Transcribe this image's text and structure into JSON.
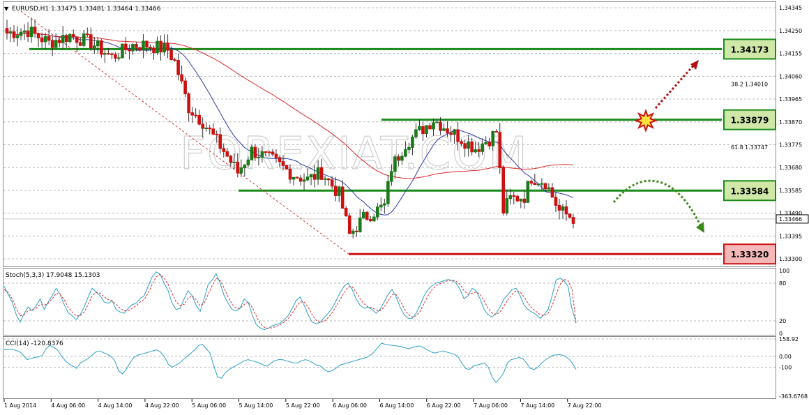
{
  "header": {
    "symbol_line": "EURUSD,H1  1.33475  1.33481  1.33464  1.33466",
    "stoch_label": "Stoch(5,3,3) 17.9048 15.1303",
    "cci_label": "CCI(14) -120.8376"
  },
  "watermark": "FOREXIAT.COM",
  "colors": {
    "support_resistance": "#1a8a1a",
    "low_level": "#cc1111",
    "bull_candle": "#1a7a1a",
    "bear_candle": "#cc1111",
    "fast_ma": "#2a3aa8",
    "slow_ma": "#dd2a2a",
    "stoch_main": "#2aa0c8",
    "stoch_signal": "#dd2a2a",
    "cci_line": "#2aa0c8",
    "up_arrow": "#b01010",
    "down_arrow": "#3a8a1a",
    "level_box_green": "#cfe8a8",
    "level_box_red": "#f5b8b8"
  },
  "chart_data": [
    {
      "type": "candlestick",
      "title": "EURUSD,H1",
      "ylim": [
        1.3328,
        1.3436
      ],
      "yticks": [
        "1.34345",
        "1.34250",
        "1.34155",
        "1.34060",
        "1.33965",
        "1.33870",
        "1.33775",
        "1.33680",
        "1.33585",
        "1.33490",
        "1.33395",
        "1.33300"
      ],
      "xticks": [
        "1 Aug 2014",
        "4 Aug 06:00",
        "4 Aug 14:00",
        "4 Aug 22:00",
        "5 Aug 06:00",
        "5 Aug 14:00",
        "5 Aug 22:00",
        "6 Aug 06:00",
        "6 Aug 14:00",
        "6 Aug 22:00",
        "7 Aug 06:00",
        "7 Aug 14:00",
        "7 Aug 22:00"
      ],
      "current_price": "1.33466",
      "levels": [
        {
          "label": "1.34173",
          "value": 1.34173,
          "kind": "resistance"
        },
        {
          "label": "1.33879",
          "value": 1.33879,
          "kind": "resistance"
        },
        {
          "label": "1.33584",
          "value": 1.33584,
          "kind": "support"
        },
        {
          "label": "1.33320",
          "value": 1.3332,
          "kind": "support"
        }
      ],
      "fib_levels": [
        {
          "pct": "38.2",
          "price": "1.34010",
          "value": 1.3401
        },
        {
          "pct": "61.8",
          "price": "1.33747",
          "value": 1.33747
        }
      ],
      "grid": true
    },
    {
      "type": "line",
      "title": "Stoch(5,3,3)",
      "ylim": [
        0,
        100
      ],
      "yticks": [
        "100",
        "80",
        "20",
        "0"
      ],
      "series": [
        {
          "name": "Stoch main",
          "values": [
            75,
            62,
            50,
            30,
            18,
            32,
            42,
            36,
            44,
            55,
            38,
            50,
            60,
            72,
            62,
            46,
            33,
            28,
            22,
            30,
            42,
            58,
            72,
            66,
            60,
            50,
            48,
            52,
            38,
            34,
            32,
            40,
            46,
            48,
            56,
            60,
            75,
            90,
            98,
            94,
            80,
            68,
            48,
            38,
            40,
            55,
            68,
            60,
            45,
            35,
            55,
            78,
            85,
            95,
            80,
            60,
            48,
            38,
            36,
            40,
            55,
            50,
            30,
            14,
            9,
            6,
            8,
            12,
            14,
            16,
            22,
            28,
            40,
            52,
            58,
            45,
            30,
            18,
            15,
            18,
            25,
            32,
            40,
            52,
            65,
            75,
            80,
            70,
            55,
            45,
            40,
            42,
            38,
            32,
            38,
            50,
            62,
            70,
            58,
            42,
            30,
            24,
            24,
            32,
            45,
            60,
            70,
            76,
            80,
            82,
            84,
            86,
            84,
            80,
            70,
            55,
            60,
            72,
            68,
            55,
            38,
            30,
            26,
            32,
            42,
            55,
            62,
            70,
            72,
            60,
            45,
            38,
            34,
            30,
            24,
            30,
            38,
            60,
            85,
            88,
            84,
            75,
            38,
            17.9
          ]
        },
        {
          "name": "Stoch signal",
          "values": [
            70,
            65,
            55,
            40,
            28,
            30,
            36,
            38,
            40,
            46,
            45,
            48,
            55,
            64,
            62,
            54,
            42,
            34,
            28,
            28,
            34,
            46,
            60,
            65,
            64,
            58,
            54,
            52,
            46,
            40,
            36,
            36,
            40,
            44,
            50,
            54,
            64,
            78,
            90,
            94,
            88,
            78,
            64,
            50,
            44,
            46,
            56,
            60,
            54,
            44,
            48,
            62,
            76,
            88,
            84,
            72,
            58,
            46,
            40,
            40,
            46,
            50,
            42,
            28,
            16,
            10,
            8,
            9,
            11,
            14,
            18,
            23,
            32,
            42,
            50,
            50,
            42,
            30,
            21,
            17,
            19,
            25,
            33,
            43,
            54,
            65,
            74,
            74,
            66,
            55,
            47,
            42,
            41,
            37,
            36,
            42,
            52,
            62,
            62,
            52,
            40,
            30,
            26,
            28,
            35,
            48,
            60,
            70,
            76,
            79,
            82,
            84,
            85,
            83,
            78,
            68,
            62,
            64,
            66,
            62,
            52,
            40,
            32,
            30,
            34,
            44,
            54,
            62,
            68,
            66,
            58,
            48,
            40,
            35,
            30,
            28,
            32,
            44,
            62,
            78,
            86,
            84,
            70,
            15.13
          ]
        }
      ]
    },
    {
      "type": "line",
      "title": "CCI(14)",
      "ylim": [
        -363.6768,
        158.92
      ],
      "yticks": [
        "158.92",
        "0.00",
        "-100",
        "-363.6768"
      ],
      "series": [
        {
          "name": "CCI",
          "values": [
            60,
            62,
            66,
            55,
            45,
            10,
            -30,
            -20,
            -10,
            -5,
            10,
            70,
            100,
            80,
            60,
            5,
            -40,
            -70,
            -90,
            -110,
            -60,
            -40,
            -20,
            10,
            40,
            50,
            35,
            20,
            0,
            -40,
            -130,
            -160,
            -120,
            -60,
            -10,
            10,
            20,
            30,
            40,
            50,
            60,
            40,
            0,
            -70,
            -100,
            -80,
            -60,
            -30,
            0,
            30,
            60,
            100,
            110,
            70,
            30,
            -90,
            -190,
            -200,
            -150,
            -120,
            -100,
            -80,
            -60,
            -40,
            -30,
            -40,
            -50,
            -60,
            -80,
            -90,
            -60,
            -40,
            -30,
            -30,
            -40,
            -50,
            -60,
            -60,
            -40,
            -30,
            -40,
            -60,
            -80,
            -90,
            -120,
            -140,
            -130,
            -110,
            -80,
            -70,
            -60,
            -50,
            -40,
            -30,
            -20,
            -10,
            10,
            40,
            80,
            120,
            110,
            105,
            100,
            95,
            90,
            80,
            70,
            80,
            90,
            95,
            80,
            60,
            40,
            30,
            40,
            50,
            40,
            30,
            20,
            0,
            -60,
            -110,
            -120,
            -90,
            -80,
            -70,
            -60,
            -100,
            -190,
            -240,
            -200,
            -150,
            -60,
            -30,
            -20,
            -10,
            -20,
            -60,
            -110,
            -120,
            -100,
            -60,
            -30,
            -10,
            10,
            15,
            15,
            5,
            -20,
            -60,
            -120
          ]
        }
      ]
    }
  ]
}
